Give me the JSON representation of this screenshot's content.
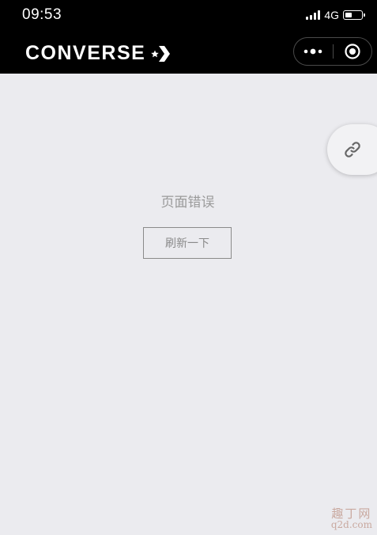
{
  "status_bar": {
    "time": "09:53",
    "network": "4G",
    "battery_level": 0.4
  },
  "nav_bar": {
    "brand": "CONVERSE",
    "brand_icon": "converse-star-chevron-icon",
    "menu_icon": "more-dots-icon",
    "close_icon": "target-circle-icon"
  },
  "floating_button": {
    "icon": "link-icon"
  },
  "content": {
    "error_message": "页面错误",
    "refresh_label": "刷新一下"
  },
  "watermark": {
    "top": "趣丁网",
    "bottom": "q2d.com"
  },
  "colors": {
    "bar_background": "#000000",
    "page_background": "#ebebef",
    "error_text": "#9a9a9a",
    "button_border": "#8a8a8a"
  }
}
